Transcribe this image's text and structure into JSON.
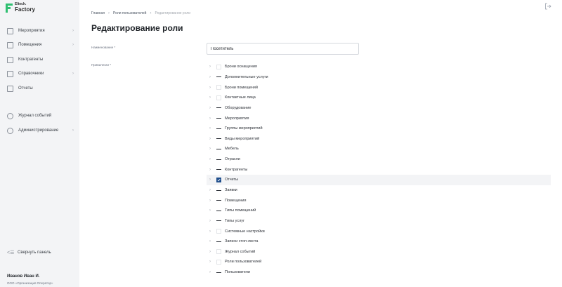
{
  "logo": {
    "line1": "Eltech.",
    "line2": "Factory"
  },
  "sidebar": {
    "items": [
      {
        "label": "Мероприятия",
        "has_chevron": true,
        "icon": "calendar-icon"
      },
      {
        "label": "Помещения",
        "has_chevron": true,
        "icon": "room-icon"
      },
      {
        "label": "Контрагенты",
        "has_chevron": false,
        "icon": "contractors-icon"
      },
      {
        "label": "Справочники",
        "has_chevron": true,
        "icon": "book-icon"
      },
      {
        "label": "Отчеты",
        "has_chevron": false,
        "icon": "report-icon"
      },
      {
        "label": "Журнал событий",
        "has_chevron": false,
        "icon": "clock-icon"
      },
      {
        "label": "Администрирование",
        "has_chevron": true,
        "icon": "gear-icon"
      }
    ],
    "collapse_label": "Свернуть панель",
    "user_name": "Иванов Иван И.",
    "user_org": "ООО «Организация Оператор»"
  },
  "breadcrumb": {
    "items": [
      "Главная",
      "Роли пользователей"
    ],
    "current": "Редактирование роли"
  },
  "page": {
    "title": "Редактирование роли",
    "name_label": "Наименование *",
    "name_value": "Посетитель",
    "privileges_label": "Привилегии *"
  },
  "privileges": [
    {
      "label": "Брони оснащения",
      "state": "unchecked"
    },
    {
      "label": "Дополнительные услуги",
      "state": "indeterminate"
    },
    {
      "label": "Брони помещений",
      "state": "unchecked"
    },
    {
      "label": "Контактные лица",
      "state": "unchecked"
    },
    {
      "label": "Оборудование",
      "state": "indeterminate"
    },
    {
      "label": "Мероприятия",
      "state": "indeterminate"
    },
    {
      "label": "Группы мероприятий",
      "state": "indeterminate"
    },
    {
      "label": "Виды мероприятий",
      "state": "indeterminate"
    },
    {
      "label": "Мебель",
      "state": "indeterminate"
    },
    {
      "label": "Отрасли",
      "state": "indeterminate"
    },
    {
      "label": "Контрагенты",
      "state": "indeterminate"
    },
    {
      "label": "Отчеты",
      "state": "checked",
      "selected": true
    },
    {
      "label": "Заявки",
      "state": "indeterminate"
    },
    {
      "label": "Помещения",
      "state": "indeterminate"
    },
    {
      "label": "Типы помещений",
      "state": "indeterminate"
    },
    {
      "label": "Типы услуг",
      "state": "indeterminate"
    },
    {
      "label": "Системные настройки",
      "state": "unchecked"
    },
    {
      "label": "Записи стоп-листа",
      "state": "indeterminate"
    },
    {
      "label": "Журнал событий",
      "state": "unchecked"
    },
    {
      "label": "Роли пользователей",
      "state": "unchecked"
    },
    {
      "label": "Пользователи",
      "state": "indeterminate"
    }
  ],
  "colors": {
    "accent": "#1f4e8c",
    "logo": "#2fbf71",
    "sidebar_bg": "#f3f4f6"
  }
}
